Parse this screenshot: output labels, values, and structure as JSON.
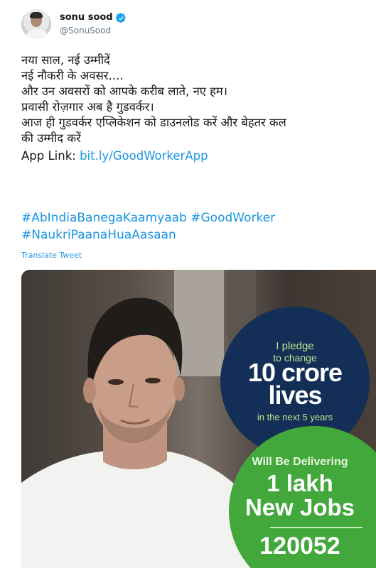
{
  "user": {
    "display_name": "sonu sood",
    "handle": "@SonuSood",
    "verified": true,
    "avatar_icon": "profile-avatar"
  },
  "tweet": {
    "lines": [
      "नया साल, नई उम्मीदें",
      "नई नौकरी के अवसर....",
      "और उन अवसरों को आपके करीब लाते, नए हम।",
      "प्रवासी रोज़गार अब है गुडवर्कर।",
      "आज ही गुडवर्कर एप्लिकेशन को डाउनलोड करें और बेहतर कल",
      "की उम्मीद करें"
    ],
    "app_link_label": "App Link: ",
    "app_link_url": "bit.ly/GoodWorkerApp",
    "hashtag_1": "#AbIndiaBanegaKaamyaab",
    "hashtag_2": "#GoodWorker",
    "hashtag_3": "#NaukriPaanaHuaAasaan",
    "translate_label": "Translate Tweet"
  },
  "media": {
    "pledge_line1": "I pledge",
    "pledge_line2": "to change",
    "pledge_big1": "10 crore",
    "pledge_big2": "lives",
    "pledge_line3": "in the next 5 years",
    "delivering_label": "Will Be Delivering",
    "jobs_line1": "1 lakh",
    "jobs_line2": "New Jobs",
    "counter": "120052"
  },
  "colors": {
    "link": "#1b95e0",
    "verified_badge": "#1da1f2",
    "badge_navy": "#142f57",
    "badge_green": "#43a83b"
  }
}
